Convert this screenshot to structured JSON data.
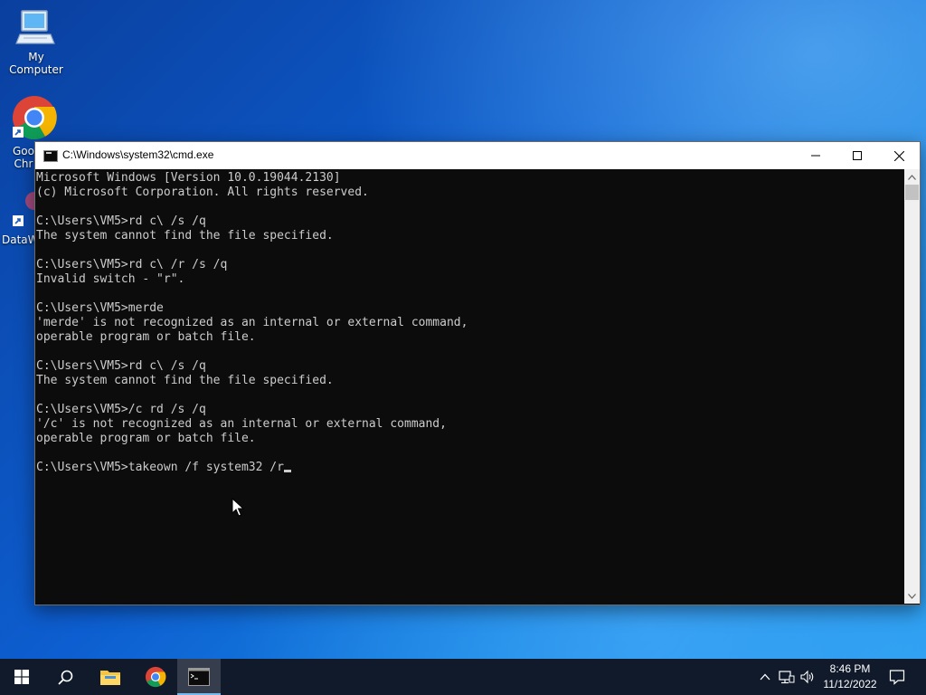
{
  "desktop": {
    "icons": [
      {
        "label": "My Computer"
      },
      {
        "label": "Goo\nChr"
      },
      {
        "label": "DataW"
      }
    ]
  },
  "cmd": {
    "title": "C:\\Windows\\system32\\cmd.exe",
    "lines": [
      "Microsoft Windows [Version 10.0.19044.2130]",
      "(c) Microsoft Corporation. All rights reserved.",
      "",
      "C:\\Users\\VM5>rd c\\ /s /q",
      "The system cannot find the file specified.",
      "",
      "C:\\Users\\VM5>rd c\\ /r /s /q",
      "Invalid switch - \"r\".",
      "",
      "C:\\Users\\VM5>merde",
      "'merde' is not recognized as an internal or external command,",
      "operable program or batch file.",
      "",
      "C:\\Users\\VM5>rd c\\ /s /q",
      "The system cannot find the file specified.",
      "",
      "C:\\Users\\VM5>/c rd /s /q",
      "'/c' is not recognized as an internal or external command,",
      "operable program or batch file.",
      ""
    ],
    "input_line": "C:\\Users\\VM5>takeown /f system32 /r"
  },
  "taskbar": {
    "clock_time": "8:46 PM",
    "clock_date": "11/12/2022"
  },
  "colors": {
    "console_bg": "#0c0c0c",
    "console_fg": "#cccccc",
    "taskbar_bg": "#101a2b",
    "active_indicator": "#76b9ed"
  }
}
